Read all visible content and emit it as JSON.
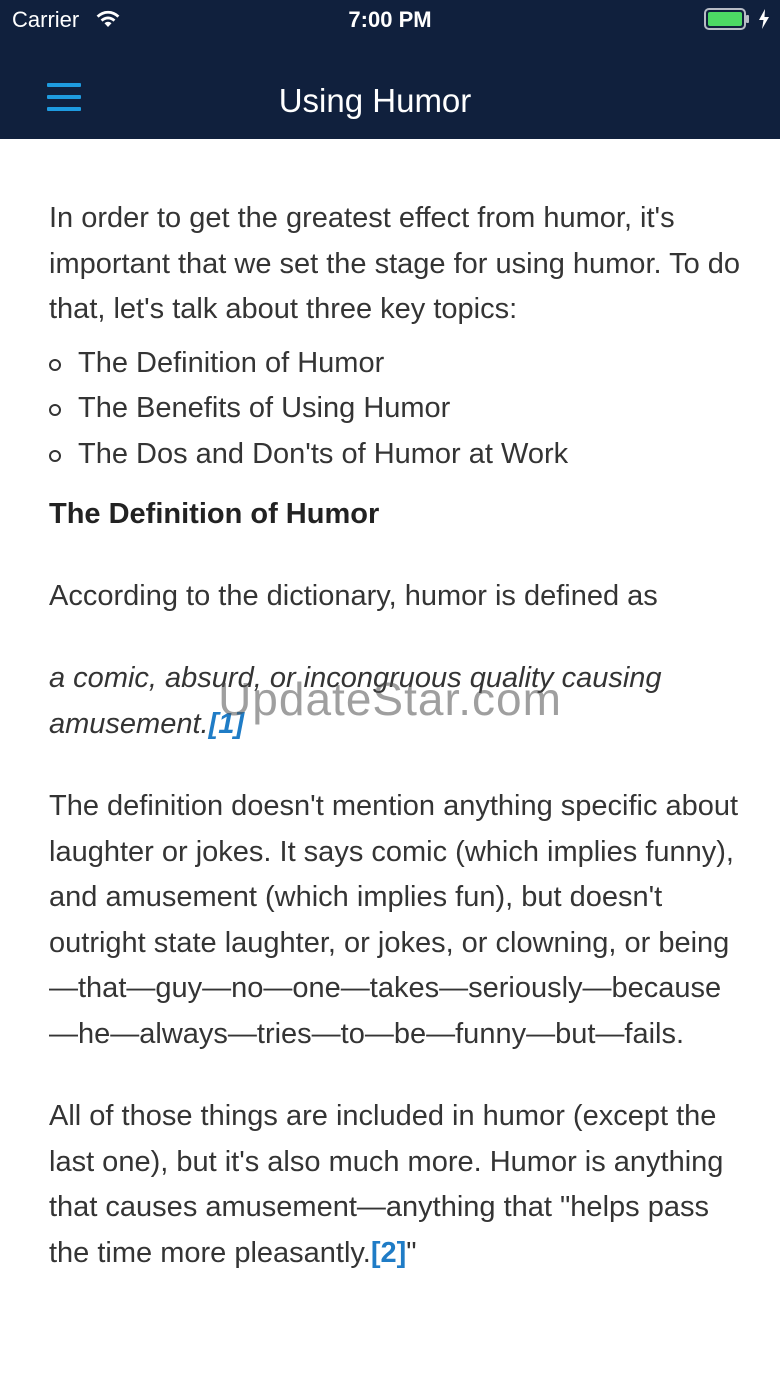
{
  "status_bar": {
    "carrier": "Carrier",
    "time": "7:00 PM",
    "battery_color": "#4cd964"
  },
  "nav": {
    "title": "Using Humor",
    "menu_icon": "hamburger-menu-icon",
    "bg_color": "#10203d",
    "accent_color": "#1e9be0"
  },
  "content": {
    "intro": "In order to get the greatest effect from humor, it's important that we set the stage for using humor. To do that, let's talk about three key topics:",
    "topics": [
      "The Definition of Humor",
      "The Benefits of Using Humor",
      "The Dos and Don'ts of Humor at Work"
    ],
    "section_heading": "The Definition of Humor",
    "dictionary_intro": "According to the dictionary, humor is defined as",
    "definition_quote": "a comic, absurd, or incongruous quality causing amusement.",
    "ref1": "[1]",
    "paragraph1": "The definition doesn't mention anything specific about laughter or jokes. It says comic (which implies funny), and amusement (which implies fun), but doesn't outright state laughter, or jokes, or clowning, or being—that—guy—no—one—takes—seriously—because—he—always—tries—to—be—funny—but—fails.",
    "paragraph2_text": "All of those things are included in humor (except the last one), but it's also much more. Humor is anything that causes amusement—anything that \"helps pass the time more pleasantly.",
    "ref2": "[2]",
    "paragraph2_close": "\""
  },
  "watermark": "UpdateStar.com"
}
